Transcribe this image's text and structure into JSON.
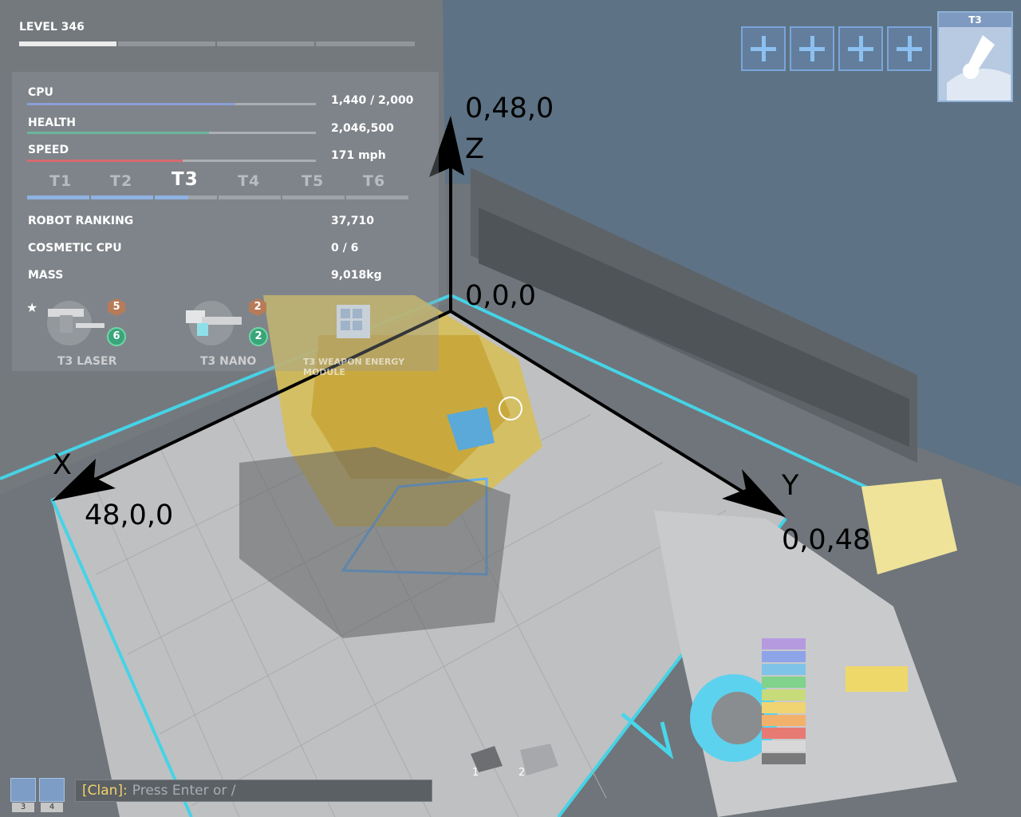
{
  "hud": {
    "level": "LEVEL 346",
    "level_progress": 0.23,
    "stats": [
      {
        "label": "CPU",
        "value": "1,440 / 2,000",
        "fill": 0.72,
        "color": "#8b9fd6"
      },
      {
        "label": "HEALTH",
        "value": "2,046,500",
        "fill": 0.63,
        "color": "#6bb59a"
      },
      {
        "label": "SPEED",
        "value": "171 mph",
        "fill": 0.54,
        "color": "#d86a6e"
      }
    ],
    "tiers": [
      "T1",
      "T2",
      "T3",
      "T4",
      "T5",
      "T6"
    ],
    "active_tier": "T3",
    "info": [
      {
        "label": "ROBOT RANKING",
        "value": "37,710"
      },
      {
        "label": "COSMETIC CPU",
        "value": "0 / 6"
      },
      {
        "label": "MASS",
        "value": "9,018kg"
      }
    ],
    "parts": [
      {
        "label": "T3 LASER",
        "hex_badge": "5",
        "ring_badge": "6",
        "icon": "laser-icon"
      },
      {
        "label": "T3 NANO",
        "hex_badge": "2",
        "ring_badge": "2",
        "icon": "nano-icon"
      },
      {
        "label": "T3 WEAPON ENERGY MODULE",
        "icon": "energy-module-icon"
      }
    ]
  },
  "toolbar": {
    "slots": [
      "add-slot",
      "add-slot",
      "add-slot",
      "add-slot"
    ],
    "tool_tier": "T3",
    "tool_icon": "wrench-icon"
  },
  "axes": {
    "origin": "0,0,0",
    "z_label": "Z",
    "z_end": "0,48,0",
    "x_label": "X",
    "x_end": "48,0,0",
    "y_label": "Y",
    "y_end": "0,0,48"
  },
  "scene": {
    "robot_marker_labels": [
      "1",
      "2"
    ]
  },
  "chat": {
    "channel": "[Clan]:",
    "placeholder": "Press Enter or /",
    "counts": [
      "3",
      "4"
    ]
  }
}
